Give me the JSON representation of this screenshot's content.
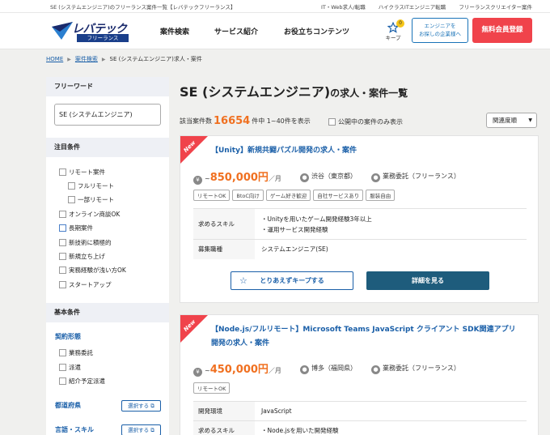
{
  "topbar": {
    "title": "SE (システムエンジニア)のフリーランス案件一覧【レバテックフリーランス】",
    "links": [
      "IT・Web求人/転職",
      "ハイクラスITエンジニア転職",
      "フリーランスクリエイター案件"
    ]
  },
  "header": {
    "logo_name": "レバテック",
    "logo_sub": "フリーランス",
    "nav": [
      "案件検索",
      "サービス紹介",
      "お役立ちコンテンツ"
    ],
    "keep_label": "キープ",
    "keep_count": "0",
    "company_button_line1": "エンジニアを",
    "company_button_line2": "お探しの企業様へ",
    "register_button": "無料会員登録"
  },
  "breadcrumb": {
    "home": "HOME",
    "search": "案件検索",
    "current": "SE (システムエンジニア)求人・案件"
  },
  "sidebar": {
    "freeword_heading": "フリーワード",
    "freeword_value": "SE (システムエンジニア)",
    "attention_heading": "注目条件",
    "attention": [
      "リモート案件",
      "フルリモート",
      "一部リモート",
      "オンライン商談OK",
      "長期案件",
      "新技術に積極的",
      "新規立ち上げ",
      "実務経験が浅い方OK",
      "スタートアップ"
    ],
    "basic_heading": "基本条件",
    "contract_heading": "契約形態",
    "contract": [
      "業務委託",
      "派遣",
      "紹介予定派遣"
    ],
    "prefecture_heading": "都道府県",
    "skill_heading": "言語・スキル",
    "select_label": "選択する"
  },
  "main": {
    "title_main": "SE (システムエンジニア)",
    "title_suffix": "の求人・案件一覧",
    "count_prefix": "該当案件数",
    "count_value": "16654",
    "count_suffix": "件中 1~40件を表示",
    "public_only": "公開中の案件のみ表示",
    "sort": "関連度順"
  },
  "jobs": [
    {
      "new": "New",
      "title": "【Unity】新規共闘パズル開発の求人・案件",
      "wage_prefix": "~",
      "wage": "850,000円",
      "wage_unit": "／月",
      "location": "渋谷（東京都）",
      "contract": "業務委託（フリーランス）",
      "tags": [
        "リモートOK",
        "BtoC向け",
        "ゲーム好き歓迎",
        "自社サービスあり",
        "服装自由"
      ],
      "rows": [
        {
          "key": "求めるスキル",
          "values": [
            "・Unityを用いたゲーム開発経験3年以上",
            "・運用サービス開発経験"
          ]
        },
        {
          "key": "募集職種",
          "values": [
            "システムエンジニア(SE)"
          ]
        }
      ],
      "keep_button": "とりあえずキープする",
      "detail_button": "詳細を見る"
    },
    {
      "new": "New",
      "title": "【Node.js/フルリモート】Microsoft Teams JavaScript クライアント SDK関連アプリ開発の求人・案件",
      "wage_prefix": "~",
      "wage": "450,000円",
      "wage_unit": "／月",
      "location": "博多（福岡県）",
      "contract": "業務委託（フリーランス）",
      "tags": [
        "リモートOK"
      ],
      "rows": [
        {
          "key": "開発環境",
          "values": [
            "JavaScript"
          ]
        },
        {
          "key": "求めるスキル",
          "values": [
            "・Node.jsを用いた開発経験"
          ]
        }
      ]
    }
  ],
  "colors": {
    "accent_orange": "#f07020",
    "brand_red": "#f0434b",
    "link_blue": "#1a5fa8",
    "detail_button": "#1e5c7c"
  }
}
